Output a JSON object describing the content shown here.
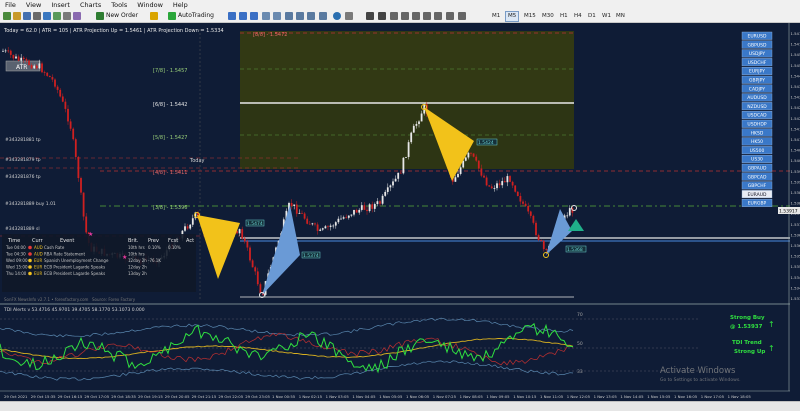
{
  "menu": [
    "File",
    "View",
    "Insert",
    "Charts",
    "Tools",
    "Window",
    "Help"
  ],
  "toolbar": {
    "new_order": "New Order",
    "autotrading": "AutoTrading",
    "timeframes": [
      "M1",
      "M5",
      "M15",
      "M30",
      "H1",
      "H4",
      "D1",
      "W1",
      "MN"
    ],
    "active_timeframe": "M5"
  },
  "info": {
    "line1": "Today = 62.0  |  ATR = 105  |  ATR Projection Up = 1.5461  |  ATR Projection Down = 1.5334"
  },
  "atr_button": "ATR",
  "murrey": [
    "[8/8] - 1.5472",
    "[7/8] - 1.5457",
    "[6/8] - 1.5442",
    "[5/8] - 1.5427",
    "[4/8] - 1.5411",
    "[3/8] - 1.5396"
  ],
  "left_labels": [
    "#343281881 tp",
    "#343281879 tp",
    "#343281876 tp",
    "#343281889 buy 1.01",
    "#343281889 sl"
  ],
  "today_label": "Today",
  "pattern_labels": [
    "1.5474",
    "1.5374",
    "1.5424",
    "1.5368"
  ],
  "price_axis": [
    "1.54755",
    "1.54710",
    "1.54520",
    "1.54565",
    "1.54420",
    "1.54385",
    "1.54330",
    "1.54285",
    "1.54210",
    "1.54170",
    "1.54125",
    "1.54080",
    "1.54025",
    "1.53990",
    "1.53945",
    "1.53890",
    "1.53825",
    "1.53780",
    "1.53730",
    "1.53685",
    "1.53640",
    "1.53565",
    "1.53520",
    "1.53480",
    "1.53435",
    "1.53375"
  ],
  "current_price": "1.53917",
  "symbols": [
    "EURUSD",
    "GBPUSD",
    "USDJPY",
    "USDCHF",
    "EURJPY",
    "GBPJPY",
    "CADJPY",
    "AUDUSD",
    "NZDUSD",
    "USDCAD",
    "USDHDP",
    "HKSD",
    "HK50",
    "US500",
    "US30",
    "GBPAUD",
    "GBPCAD",
    "GBPCHF",
    "EURAUD",
    "EURGBP"
  ],
  "news": {
    "headers": [
      "Time",
      "Curr",
      "Event",
      "Brit.",
      "Prev",
      "Fcst",
      "Act"
    ],
    "rows": [
      [
        "Tue 04:00",
        "AUD",
        "Cash Rate",
        "10th hrs",
        "0.10%",
        "0.10%",
        ""
      ],
      [
        "Tue 04:30",
        "AUD",
        "RBA Rate Statement",
        "10th hrs",
        "",
        "",
        " "
      ],
      [
        "Wed 09:00",
        "EUR",
        "Spanish Unemployment Change",
        "12day 2h",
        "-76.1K",
        "",
        ""
      ],
      [
        "Wed 15:00",
        "EUR",
        "ECB President Lagarde Speaks",
        "12day 2h",
        "",
        "",
        ""
      ],
      [
        "Thu 14:00",
        "EUR",
        "ECB President Lagarde Speaks",
        "13day 2h",
        "",
        "",
        ""
      ]
    ]
  },
  "footer_left": "SonFX NewsInfo v2.7.1  •  forexfactory.com",
  "footer_mid": "Source: Forex Factory",
  "tdi": {
    "title": "TDI Alerts  v 53.4716 45.9701 39.4705 58.1770 53.1073 0.000",
    "levels": [
      "70",
      "50",
      "33"
    ],
    "signal_title": "Strong Buy",
    "signal_price": "@ 1.53937",
    "trend_title": "TDI Trend",
    "trend_value": "Strong Up"
  },
  "time_axis": [
    "29 Oct 2021",
    "29 Oct 15:35",
    "29 Oct 16:15",
    "29 Oct 17:05",
    "29 Oct 18:35",
    "29 Oct 19:15",
    "29 Oct 20:05",
    "29 Oct 21:15",
    "29 Oct 22:05",
    "29 Oct 23:05",
    "1 Nov 00:55",
    "1 Nov 02:15",
    "1 Nov 03:05",
    "1 Nov 04:05",
    "1 Nov 05:05",
    "1 Nov 06:05",
    "1 Nov 07:25",
    "1 Nov 08:05",
    "1 Nov 09:05",
    "1 Nov 10:15",
    "1 Nov 11:05",
    "1 Nov 12:05",
    "1 Nov 13:05",
    "1 Nov 14:05",
    "1 Nov 15:05",
    "1 Nov 16:05",
    "1 Nov 17:05",
    "1 Nov 18:05"
  ],
  "watermark": {
    "line1": "Activate Windows",
    "line2": "Go to Settings to activate Windows."
  }
}
